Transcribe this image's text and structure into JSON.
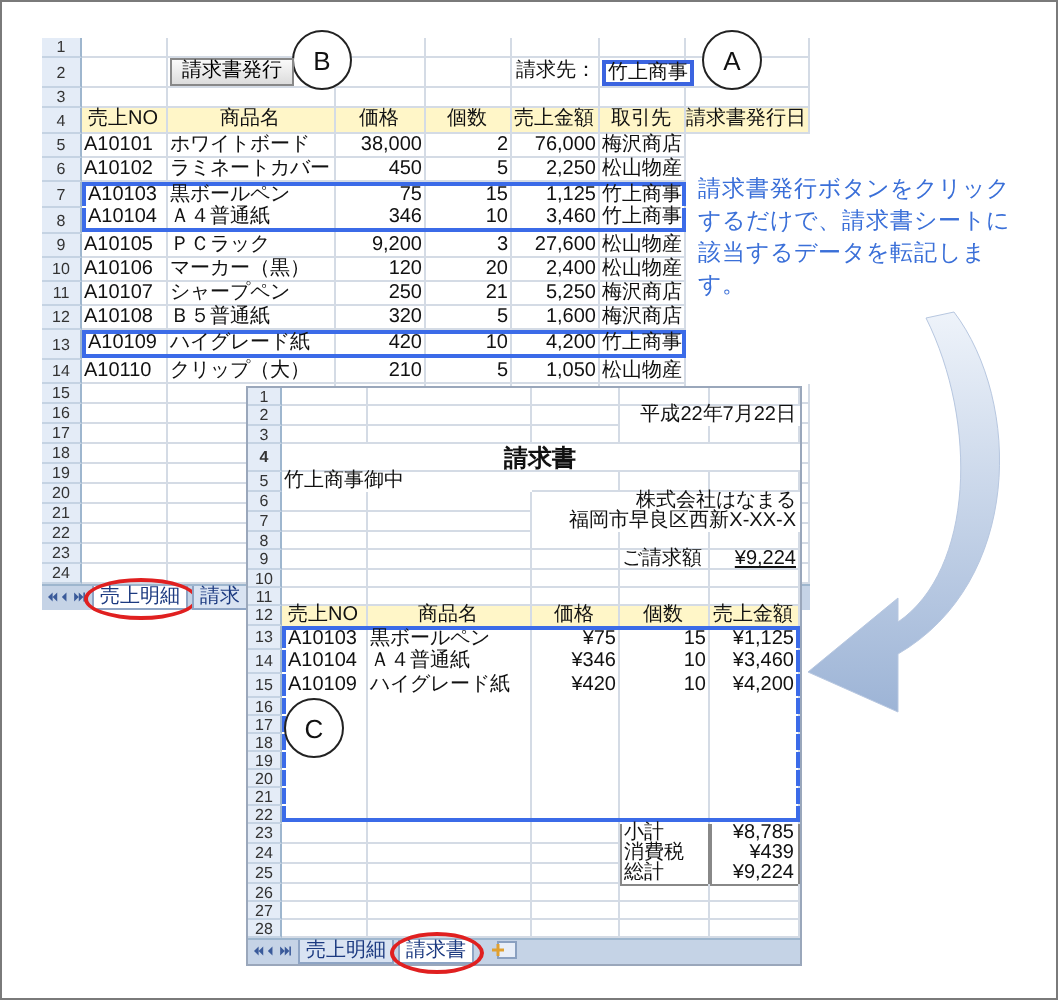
{
  "sales_sheet": {
    "button": "請求書発行",
    "billing_label": "請求先：",
    "billing_value": "竹上商事",
    "rows": [
      {
        "number": "1",
        "kind": "blank"
      },
      {
        "number": "2",
        "kind": "toolbar"
      },
      {
        "number": "3",
        "kind": "blank"
      },
      {
        "number": "4",
        "kind": "header",
        "cells": [
          "売上NO",
          "商品名",
          "価格",
          "個数",
          "売上金額",
          "取引先",
          "請求書発行日"
        ]
      },
      {
        "number": "5",
        "kind": "data",
        "highlighted": false,
        "cells": [
          "A10101",
          "ホワイトボード",
          "38,000",
          "2",
          "76,000",
          "梅沢商店"
        ]
      },
      {
        "number": "6",
        "kind": "data",
        "highlighted": false,
        "cells": [
          "A10102",
          "ラミネートカバー",
          "450",
          "5",
          "2,250",
          "松山物産"
        ]
      },
      {
        "number": "7",
        "kind": "data",
        "highlighted": true,
        "cells": [
          "A10103",
          "黒ボールペン",
          "75",
          "15",
          "1,125",
          "竹上商事"
        ]
      },
      {
        "number": "8",
        "kind": "data",
        "highlighted": true,
        "cells": [
          "A10104",
          "Ａ４普通紙",
          "346",
          "10",
          "3,460",
          "竹上商事"
        ]
      },
      {
        "number": "9",
        "kind": "data",
        "highlighted": false,
        "cells": [
          "A10105",
          "ＰＣラック",
          "9,200",
          "3",
          "27,600",
          "松山物産"
        ]
      },
      {
        "number": "10",
        "kind": "data",
        "highlighted": false,
        "cells": [
          "A10106",
          "マーカー（黒）",
          "120",
          "20",
          "2,400",
          "松山物産"
        ]
      },
      {
        "number": "11",
        "kind": "data",
        "highlighted": false,
        "cells": [
          "A10107",
          "シャープペン",
          "250",
          "21",
          "5,250",
          "梅沢商店"
        ]
      },
      {
        "number": "12",
        "kind": "data",
        "highlighted": false,
        "cells": [
          "A10108",
          "Ｂ５普通紙",
          "320",
          "5",
          "1,600",
          "梅沢商店"
        ]
      },
      {
        "number": "13",
        "kind": "data",
        "highlighted": true,
        "cells": [
          "A10109",
          "ハイグレード紙",
          "420",
          "10",
          "4,200",
          "竹上商事"
        ]
      },
      {
        "number": "14",
        "kind": "data",
        "highlighted": false,
        "cells": [
          "A10110",
          "クリップ（大）",
          "210",
          "5",
          "1,050",
          "松山物産"
        ]
      },
      {
        "number": "15",
        "kind": "blank"
      },
      {
        "number": "16",
        "kind": "blank"
      },
      {
        "number": "17",
        "kind": "blank"
      },
      {
        "number": "18",
        "kind": "blank"
      },
      {
        "number": "19",
        "kind": "blank"
      },
      {
        "number": "20",
        "kind": "blank"
      },
      {
        "number": "21",
        "kind": "blank"
      },
      {
        "number": "22",
        "kind": "blank"
      },
      {
        "number": "23",
        "kind": "blank"
      },
      {
        "number": "24",
        "kind": "blank"
      }
    ],
    "tabs": [
      {
        "label": "売上明細",
        "selected": true,
        "circled": true
      },
      {
        "label": "請求",
        "selected": false,
        "circled": false
      }
    ]
  },
  "invoice_sheet": {
    "rows": [
      {
        "number": "1",
        "kind": "blank"
      },
      {
        "number": "2",
        "kind": "date",
        "text": "平成22年7月22日"
      },
      {
        "number": "3",
        "kind": "blank"
      },
      {
        "number": "4",
        "kind": "title",
        "text": "請求書"
      },
      {
        "number": "5",
        "kind": "recipient",
        "text": "竹上商事御中"
      },
      {
        "number": "6",
        "kind": "company",
        "text": "株式会社はなまる"
      },
      {
        "number": "7",
        "kind": "company",
        "text": "福岡市早良区西新X-XX-X"
      },
      {
        "number": "8",
        "kind": "blank"
      },
      {
        "number": "9",
        "kind": "amount",
        "label": "ご請求額",
        "value": "¥9,224"
      },
      {
        "number": "10",
        "kind": "blank"
      },
      {
        "number": "11",
        "kind": "blank"
      },
      {
        "number": "12",
        "kind": "header",
        "cells": [
          "売上NO",
          "商品名",
          "価格",
          "個数",
          "売上金額"
        ]
      },
      {
        "number": "13",
        "kind": "item",
        "highlighted": true,
        "cells": [
          "A10103",
          "黒ボールペン",
          "¥75",
          "15",
          "¥1,125"
        ]
      },
      {
        "number": "14",
        "kind": "item",
        "highlighted": true,
        "cells": [
          "A10104",
          "Ａ４普通紙",
          "¥346",
          "10",
          "¥3,460"
        ]
      },
      {
        "number": "15",
        "kind": "item",
        "highlighted": true,
        "cells": [
          "A10109",
          "ハイグレード紙",
          "¥420",
          "10",
          "¥4,200"
        ]
      },
      {
        "number": "16",
        "kind": "blank",
        "highlighted": true
      },
      {
        "number": "17",
        "kind": "blank",
        "highlighted": true
      },
      {
        "number": "18",
        "kind": "blank",
        "highlighted": true
      },
      {
        "number": "19",
        "kind": "blank",
        "highlighted": true
      },
      {
        "number": "20",
        "kind": "blank",
        "highlighted": true
      },
      {
        "number": "21",
        "kind": "blank",
        "highlighted": true
      },
      {
        "number": "22",
        "kind": "blank",
        "highlighted": true
      },
      {
        "number": "23",
        "kind": "total",
        "label": "小計",
        "value": "¥8,785"
      },
      {
        "number": "24",
        "kind": "total",
        "label": "消費税",
        "value": "¥439"
      },
      {
        "number": "25",
        "kind": "total",
        "label": "総計",
        "value": "¥9,224"
      },
      {
        "number": "26",
        "kind": "blank"
      },
      {
        "number": "27",
        "kind": "blank"
      },
      {
        "number": "28",
        "kind": "blank"
      }
    ],
    "tabs": [
      {
        "label": "売上明細",
        "selected": false,
        "circled": false
      },
      {
        "label": "請求書",
        "selected": true,
        "circled": true
      }
    ]
  },
  "callouts": [
    "A",
    "B",
    "C"
  ],
  "note": "請求書発行ボタンをクリックするだけで、請求書シートに該当するデータを転記します。"
}
